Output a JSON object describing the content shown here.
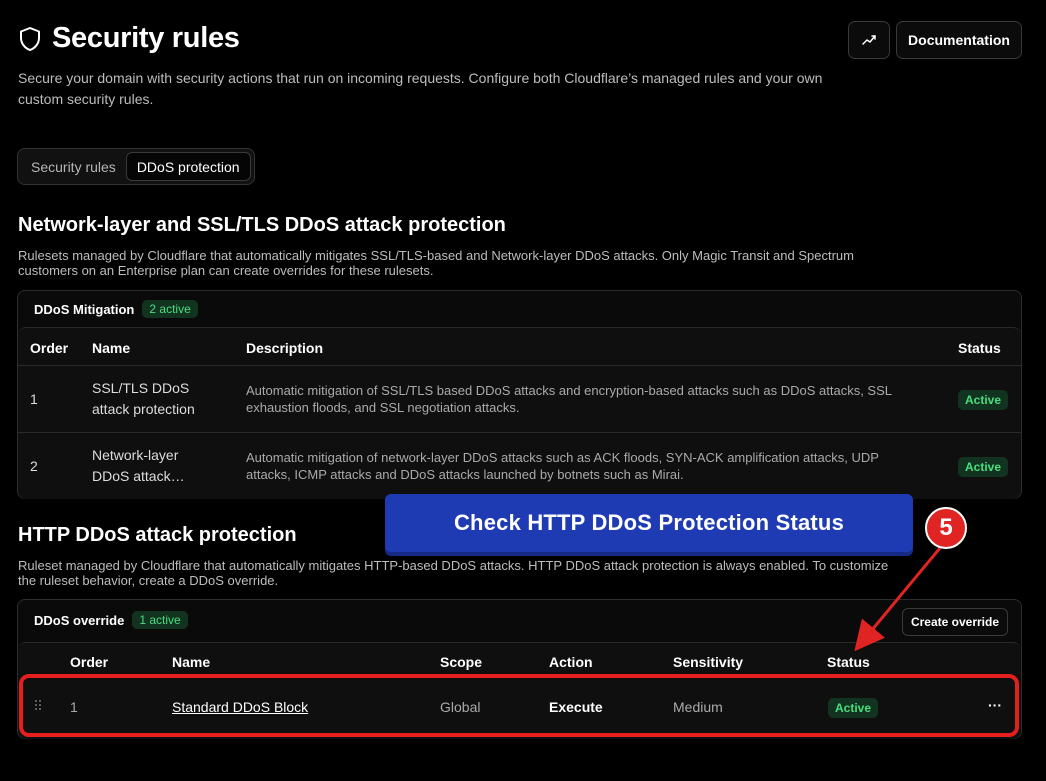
{
  "header": {
    "title": "Security rules",
    "subtitle": "Secure your domain with security actions that run on incoming requests. Configure both Cloudflare’s managed rules and your own custom security rules.",
    "documentation_label": "Documentation"
  },
  "tabs": [
    {
      "label": "Security rules",
      "active": false
    },
    {
      "label": "DDoS protection",
      "active": true
    }
  ],
  "network_section": {
    "title": "Network-layer and SSL/TLS DDoS attack protection",
    "description": "Rulesets managed by Cloudflare that automatically mitigates SSL/TLS-based and Network-layer DDoS attacks. Only Magic Transit and Spectrum customers on an Enterprise plan can create overrides for these rulesets.",
    "panel_name": "DDoS Mitigation",
    "panel_badge": "2 active",
    "columns": {
      "order": "Order",
      "name": "Name",
      "description": "Description",
      "status": "Status"
    },
    "rows": [
      {
        "order": "1",
        "name_line1": "SSL/TLS DDoS",
        "name_line2": "attack protection",
        "description": "Automatic mitigation of SSL/TLS based DDoS attacks and encryption-based attacks such as DDoS attacks, SSL exhaustion floods, and SSL negotiation attacks.",
        "status": "Active"
      },
      {
        "order": "2",
        "name_line1": "Network-layer",
        "name_line2": "DDoS attack…",
        "description": "Automatic mitigation of network-layer DDoS attacks such as ACK floods, SYN-ACK amplification attacks, UDP attacks, ICMP attacks and DDoS attacks launched by botnets such as Mirai.",
        "status": "Active"
      }
    ]
  },
  "http_section": {
    "title": "HTTP DDoS attack protection",
    "description": "Ruleset managed by Cloudflare that automatically mitigates HTTP-based DDoS attacks. HTTP DDoS attack protection is always enabled. To customize the ruleset behavior, create a DDoS override.",
    "panel_name": "DDoS override",
    "panel_badge": "1 active",
    "create_override_label": "Create override",
    "columns": {
      "order": "Order",
      "name": "Name",
      "scope": "Scope",
      "action": "Action",
      "sensitivity": "Sensitivity",
      "status": "Status"
    },
    "rows": [
      {
        "order": "1",
        "name": "Standard DDoS Block",
        "scope": "Global",
        "action": "Execute",
        "sensitivity": "Medium",
        "status": "Active",
        "more": "···"
      }
    ]
  },
  "annotation": {
    "callout": "Check HTTP DDoS Protection Status",
    "step": "5"
  },
  "colors": {
    "accent_blue": "#1f3bb3",
    "annotation_red": "#e02424",
    "active_green": "#4ade80"
  },
  "icons": {
    "title_icon": "shield-icon",
    "header_button_icon": "external-chart-icon",
    "drag_icon": "drag-handle-icon"
  }
}
